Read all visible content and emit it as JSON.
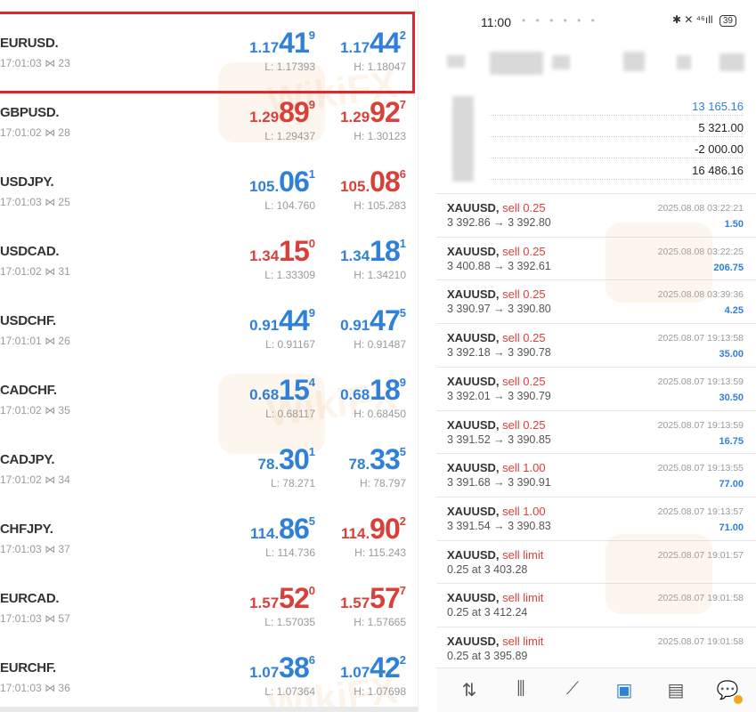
{
  "quotes": [
    {
      "symbol": "EURUSD.",
      "time": "17:01:03",
      "spread": "23",
      "bid": {
        "pre": "1.17",
        "big": "41",
        "sup": "9",
        "color": "blue"
      },
      "ask": {
        "pre": "1.17",
        "big": "44",
        "sup": "2",
        "color": "blue"
      },
      "low": "L: 1.17393",
      "high": "H: 1.18047"
    },
    {
      "symbol": "GBPUSD.",
      "time": "17:01:02",
      "spread": "28",
      "bid": {
        "pre": "1.29",
        "big": "89",
        "sup": "9",
        "color": "red"
      },
      "ask": {
        "pre": "1.29",
        "big": "92",
        "sup": "7",
        "color": "red"
      },
      "low": "L: 1.29437",
      "high": "H: 1.30123"
    },
    {
      "symbol": "USDJPY.",
      "time": "17:01:03",
      "spread": "25",
      "bid": {
        "pre": "105.",
        "big": "06",
        "sup": "1",
        "color": "blue"
      },
      "ask": {
        "pre": "105.",
        "big": "08",
        "sup": "6",
        "color": "red"
      },
      "low": "L: 104.760",
      "high": "H: 105.283"
    },
    {
      "symbol": "USDCAD.",
      "time": "17:01:02",
      "spread": "31",
      "bid": {
        "pre": "1.34",
        "big": "15",
        "sup": "0",
        "color": "red"
      },
      "ask": {
        "pre": "1.34",
        "big": "18",
        "sup": "1",
        "color": "blue"
      },
      "low": "L: 1.33309",
      "high": "H: 1.34210"
    },
    {
      "symbol": "USDCHF.",
      "time": "17:01:01",
      "spread": "26",
      "bid": {
        "pre": "0.91",
        "big": "44",
        "sup": "9",
        "color": "blue"
      },
      "ask": {
        "pre": "0.91",
        "big": "47",
        "sup": "5",
        "color": "blue"
      },
      "low": "L: 0.91167",
      "high": "H: 0.91487"
    },
    {
      "symbol": "CADCHF.",
      "time": "17:01:02",
      "spread": "35",
      "bid": {
        "pre": "0.68",
        "big": "15",
        "sup": "4",
        "color": "blue"
      },
      "ask": {
        "pre": "0.68",
        "big": "18",
        "sup": "9",
        "color": "blue"
      },
      "low": "L: 0.68117",
      "high": "H: 0.68450"
    },
    {
      "symbol": "CADJPY.",
      "time": "17:01:02",
      "spread": "34",
      "bid": {
        "pre": "78.",
        "big": "30",
        "sup": "1",
        "color": "blue"
      },
      "ask": {
        "pre": "78.",
        "big": "33",
        "sup": "5",
        "color": "blue"
      },
      "low": "L: 78.271",
      "high": "H: 78.797"
    },
    {
      "symbol": "CHFJPY.",
      "time": "17:01:03",
      "spread": "37",
      "bid": {
        "pre": "114.",
        "big": "86",
        "sup": "5",
        "color": "blue"
      },
      "ask": {
        "pre": "114.",
        "big": "90",
        "sup": "2",
        "color": "red"
      },
      "low": "L: 114.736",
      "high": "H: 115.243"
    },
    {
      "symbol": "EURCAD.",
      "time": "17:01:03",
      "spread": "57",
      "bid": {
        "pre": "1.57",
        "big": "52",
        "sup": "0",
        "color": "red"
      },
      "ask": {
        "pre": "1.57",
        "big": "57",
        "sup": "7",
        "color": "red"
      },
      "low": "L: 1.57035",
      "high": "H: 1.57665"
    },
    {
      "symbol": "EURCHF.",
      "time": "17:01:03",
      "spread": "36",
      "bid": {
        "pre": "1.07",
        "big": "38",
        "sup": "6",
        "color": "blue"
      },
      "ask": {
        "pre": "1.07",
        "big": "42",
        "sup": "2",
        "color": "blue"
      },
      "low": "L: 1.07364",
      "high": "H: 1.07698"
    }
  ],
  "watermark": "WikiFX",
  "phone": {
    "status": {
      "time": "11:00",
      "battery": "39",
      "right_icons": "✱ ✕ ⁴⁶ıll"
    },
    "balances": [
      "13 165.16",
      "5 321.00",
      "-2 000.00",
      "16 486.16"
    ],
    "trades": [
      {
        "symbol": "XAUUSD,",
        "type": "sell 0.25",
        "price": "3 392.86 → 3 392.80",
        "time": "2025.08.08 03:22:21",
        "profit": "1.50"
      },
      {
        "symbol": "XAUUSD,",
        "type": "sell 0.25",
        "price": "3 400.88 → 3 392.61",
        "time": "2025.08.08 03:22:25",
        "profit": "206.75"
      },
      {
        "symbol": "XAUUSD,",
        "type": "sell 0.25",
        "price": "3 390.97 → 3 390.80",
        "time": "2025.08.08 03:39:36",
        "profit": "4.25"
      },
      {
        "symbol": "XAUUSD,",
        "type": "sell 0.25",
        "price": "3 392.18 → 3 390.78",
        "time": "2025.08.07 19:13:58",
        "profit": "35.00"
      },
      {
        "symbol": "XAUUSD,",
        "type": "sell 0.25",
        "price": "3 392.01 → 3 390.79",
        "time": "2025.08.07 19:13:59",
        "profit": "30.50"
      },
      {
        "symbol": "XAUUSD,",
        "type": "sell 0.25",
        "price": "3 391.52 → 3 390.85",
        "time": "2025.08.07 19:13:59",
        "profit": "16.75"
      },
      {
        "symbol": "XAUUSD,",
        "type": "sell 1.00",
        "price": "3 391.68 → 3 390.91",
        "time": "2025.08.07 19:13:55",
        "profit": "77.00"
      },
      {
        "symbol": "XAUUSD,",
        "type": "sell 1.00",
        "price": "3 391.54 → 3 390.83",
        "time": "2025.08.07 19:13:57",
        "profit": "71.00"
      },
      {
        "symbol": "XAUUSD,",
        "type": "sell limit",
        "price": "0.25 at 3 403.28",
        "time": "2025.08.07 19:01:57",
        "profit": ""
      },
      {
        "symbol": "XAUUSD,",
        "type": "sell limit",
        "price": "0.25 at 3 412.24",
        "time": "2025.08.07 19:01:58",
        "profit": ""
      },
      {
        "symbol": "XAUUSD,",
        "type": "sell limit",
        "price": "0.25 at 3 395.89",
        "time": "2025.08.07 19:01:58",
        "profit": ""
      }
    ],
    "nav": [
      {
        "name": "quotes-nav-icon",
        "glyph": "⇅",
        "active": false
      },
      {
        "name": "chart-nav-icon",
        "glyph": "⫼",
        "active": false
      },
      {
        "name": "trade-nav-icon",
        "glyph": "⟋",
        "active": false
      },
      {
        "name": "history-nav-icon",
        "glyph": "▣",
        "active": true
      },
      {
        "name": "news-nav-icon",
        "glyph": "▤",
        "active": false
      },
      {
        "name": "messages-nav-icon",
        "glyph": "💬",
        "active": false
      }
    ]
  }
}
